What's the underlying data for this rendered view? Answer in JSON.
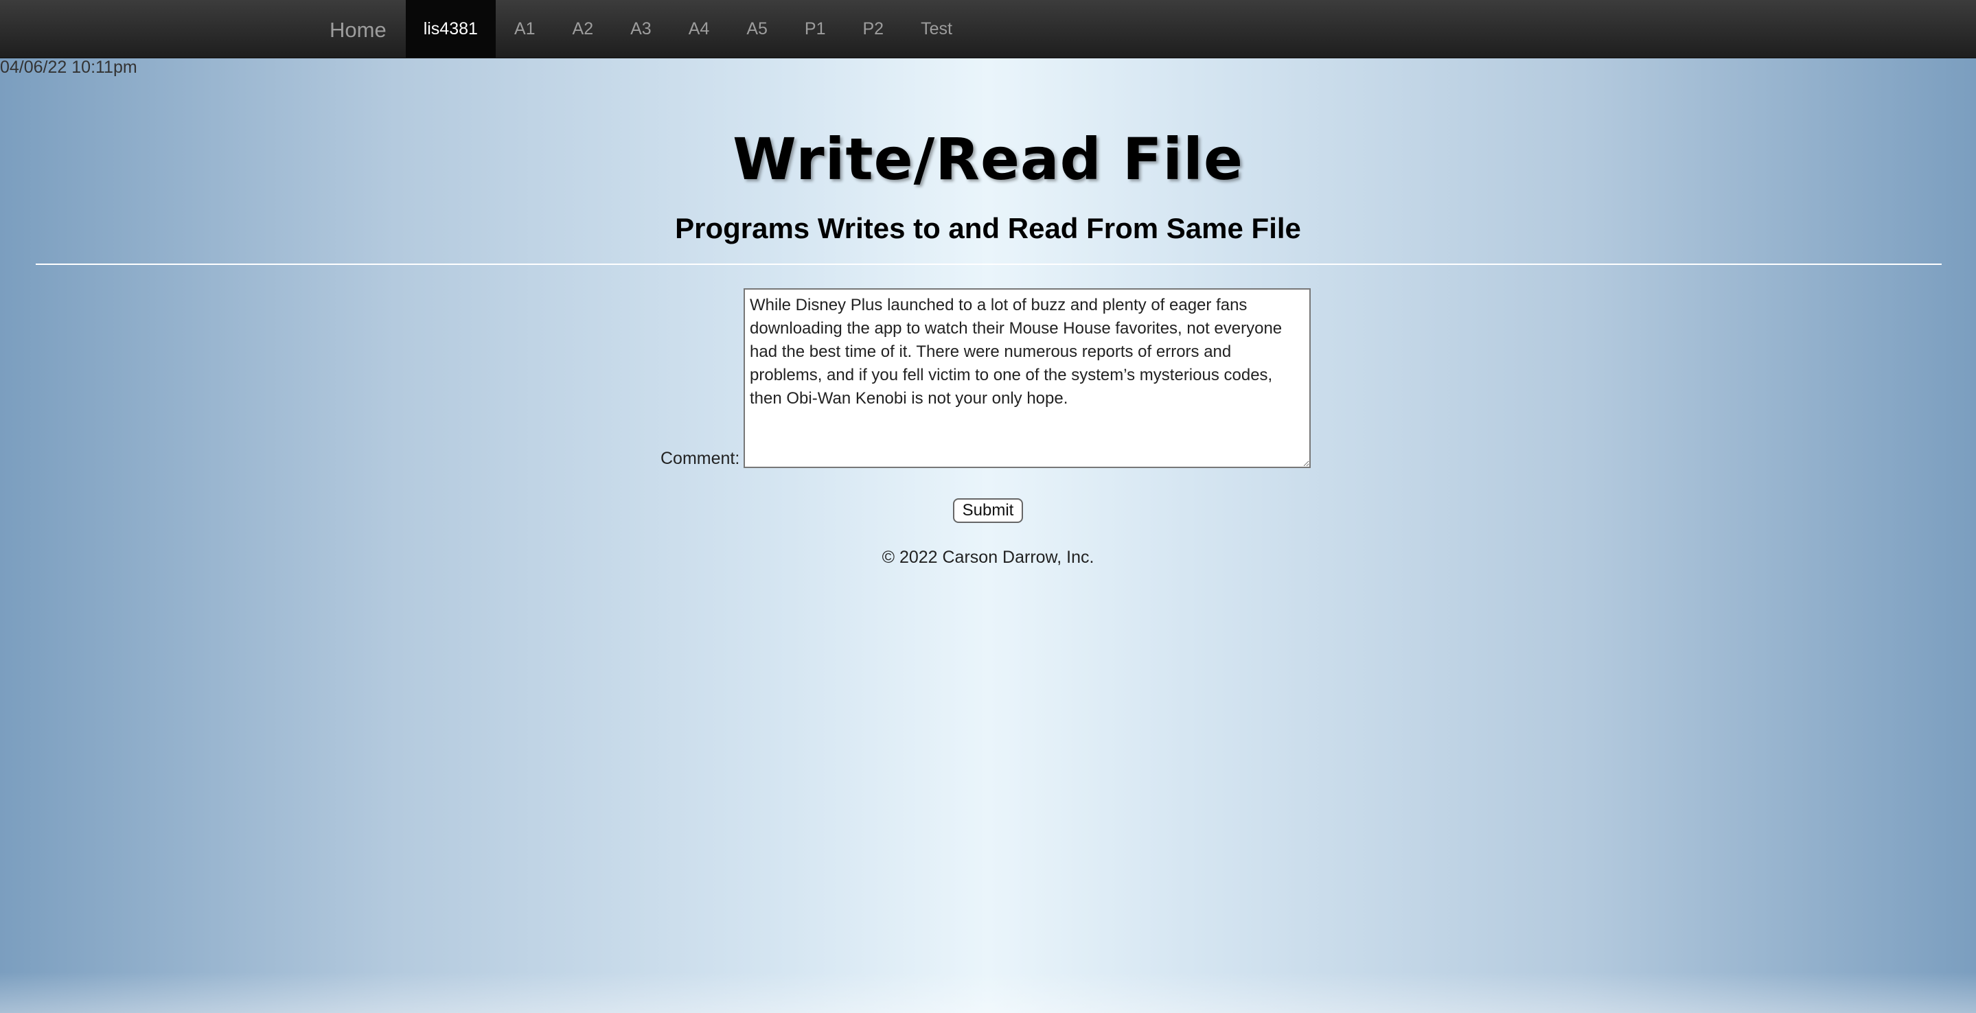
{
  "navbar": {
    "brand": "Home",
    "items": [
      {
        "label": "lis4381",
        "active": true
      },
      {
        "label": "A1",
        "active": false
      },
      {
        "label": "A2",
        "active": false
      },
      {
        "label": "A3",
        "active": false
      },
      {
        "label": "A4",
        "active": false
      },
      {
        "label": "A5",
        "active": false
      },
      {
        "label": "P1",
        "active": false
      },
      {
        "label": "P2",
        "active": false
      },
      {
        "label": "Test",
        "active": false
      }
    ]
  },
  "timestamp": "04/06/22 10:11pm",
  "page": {
    "title": "Write/Read File",
    "subtitle": "Programs Writes to and Read From Same File"
  },
  "form": {
    "comment_label": "Comment:",
    "comment_value": "While Disney Plus launched to a lot of buzz and plenty of eager fans downloading the app to watch their Mouse House favorites, not everyone had the best time of it. There were numerous reports of errors and problems, and if you fell victim to one of the system’s mysterious codes, then Obi-Wan Kenobi is not your only hope.",
    "submit_label": "Submit"
  },
  "footer": {
    "text": "© 2022 Carson Darrow, Inc."
  },
  "colors": {
    "navbar_bg": "#2a2a2a",
    "nav_active_bg": "#080808",
    "nav_text": "#9d9d9d",
    "page_gradient_edge": "#7b9ebf",
    "page_gradient_center": "#eaf5fb"
  }
}
